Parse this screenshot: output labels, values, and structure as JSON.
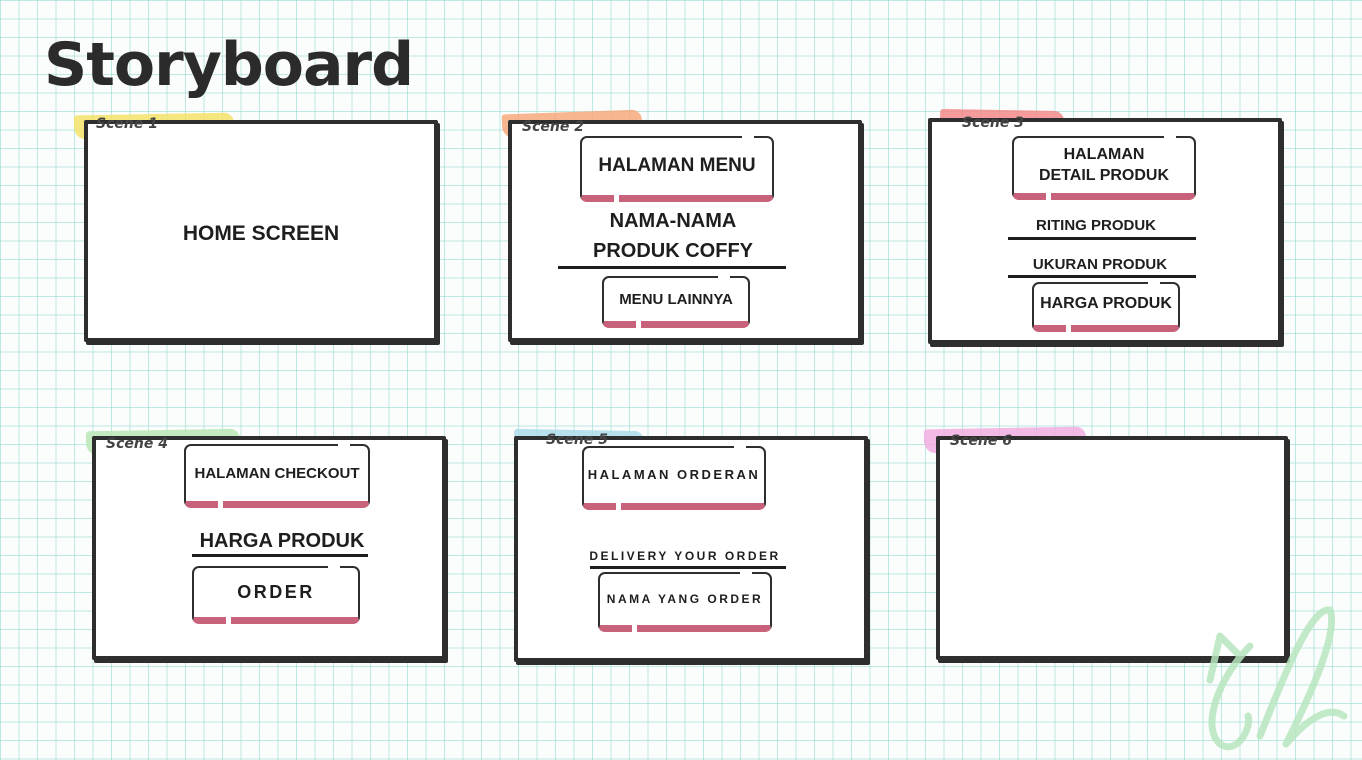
{
  "title": "Storyboard",
  "colors": {
    "frame": "#2e2e2e",
    "button_shadow": "#c8627a",
    "tape_yellow": "#f5e26a",
    "tape_orange": "#f7a97c",
    "tape_red": "#f58a8a",
    "tape_green": "#b9e8b4",
    "tape_blue": "#a9dcea",
    "tape_pink": "#f0aee0"
  },
  "scenes": [
    {
      "label": "Scene 1",
      "content": {
        "main_text": "HOME SCREEN"
      }
    },
    {
      "label": "Scene 2",
      "content": {
        "button_top": "HALAMAN MENU",
        "text_line1": "NAMA-NAMA",
        "text_line2": "PRODUK COFFY",
        "button_bottom": "MENU LAINNYA"
      }
    },
    {
      "label": "Scene 3",
      "content": {
        "button_top_line1": "HALAMAN",
        "button_top_line2": "DETAIL PRODUK",
        "text_1": "RITING PRODUK",
        "text_2": "UKURAN PRODUK",
        "button_bottom": "HARGA PRODUK"
      }
    },
    {
      "label": "Scene 4",
      "content": {
        "button_top": "HALAMAN CHECKOUT",
        "text_1": "HARGA PRODUK",
        "button_bottom": "ORDER"
      }
    },
    {
      "label": "Scene 5",
      "content": {
        "button_top": "HALAMAN ORDERAN",
        "text_1": "DELIVERY YOUR ORDER",
        "button_bottom": "NAMA YANG ORDER"
      }
    },
    {
      "label": "Scene 6",
      "content": {}
    }
  ],
  "decor": {
    "logo_icon": "cle-logo-icon"
  }
}
